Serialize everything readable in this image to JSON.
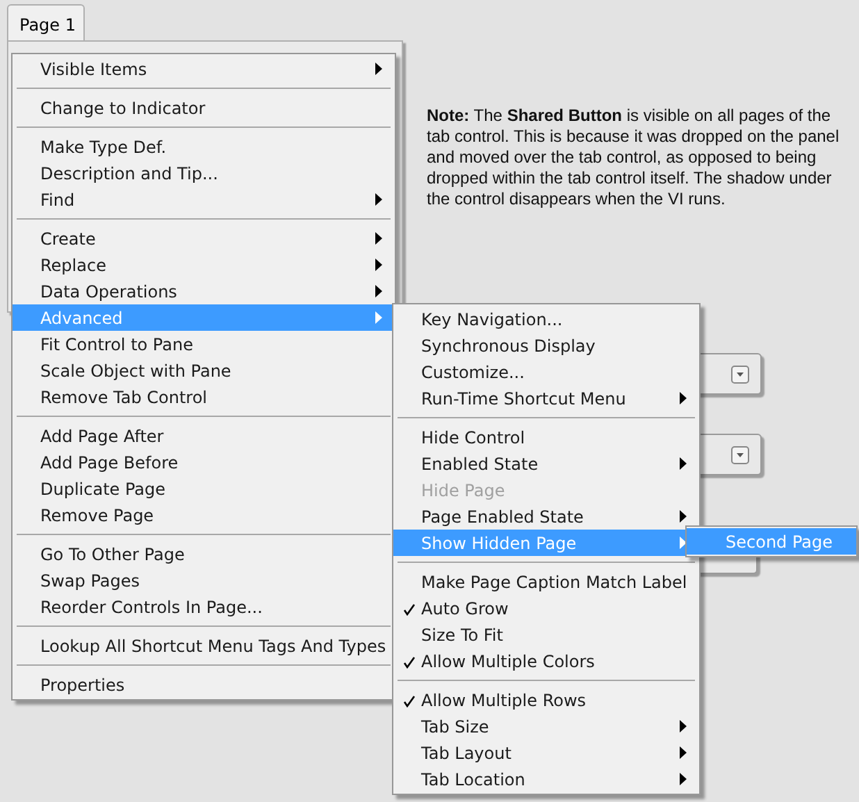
{
  "tab": {
    "label": "Page 1",
    "selected": true
  },
  "note": "**Note:** The **Shared Button** is visible on all pages of the tab control. This is because it was dropped on the panel and moved over the tab control, as opposed to being dropped within the tab control itself. The shadow under the control disappears when the VI runs.",
  "context_menu": {
    "groups": [
      [
        {
          "label": "Visible Items",
          "submenu": true,
          "selected": false
        }
      ],
      [
        {
          "label": "Change to Indicator",
          "submenu": false,
          "selected": false
        }
      ],
      [
        {
          "label": "Make Type Def.",
          "submenu": false,
          "selected": false
        },
        {
          "label": "Description and Tip...",
          "submenu": false,
          "selected": false
        },
        {
          "label": "Find",
          "submenu": true,
          "selected": false
        }
      ],
      [
        {
          "label": "Create",
          "submenu": true,
          "selected": false
        },
        {
          "label": "Replace",
          "submenu": true,
          "selected": false
        },
        {
          "label": "Data Operations",
          "submenu": true,
          "selected": false
        },
        {
          "label": "Advanced",
          "submenu": true,
          "selected": true
        },
        {
          "label": "Fit Control to Pane",
          "submenu": false,
          "selected": false
        },
        {
          "label": "Scale Object with Pane",
          "submenu": false,
          "selected": false
        },
        {
          "label": "Remove Tab Control",
          "submenu": false,
          "selected": false
        }
      ],
      [
        {
          "label": "Add Page After",
          "submenu": false,
          "selected": false
        },
        {
          "label": "Add Page Before",
          "submenu": false,
          "selected": false
        },
        {
          "label": "Duplicate Page",
          "submenu": false,
          "selected": false
        },
        {
          "label": "Remove Page",
          "submenu": false,
          "selected": false
        }
      ],
      [
        {
          "label": "Go To Other Page",
          "submenu": false,
          "selected": false
        },
        {
          "label": "Swap Pages",
          "submenu": false,
          "selected": false
        },
        {
          "label": "Reorder Controls In Page...",
          "submenu": false,
          "selected": false
        }
      ],
      [
        {
          "label": "Lookup All Shortcut Menu Tags And Types",
          "submenu": false,
          "selected": false
        }
      ],
      [
        {
          "label": "Properties",
          "submenu": false,
          "selected": false
        }
      ]
    ]
  },
  "advanced_submenu": {
    "groups": [
      [
        {
          "label": "Key Navigation...",
          "submenu": false,
          "selected": false,
          "checked": false,
          "disabled": false
        },
        {
          "label": "Synchronous Display",
          "submenu": false,
          "selected": false,
          "checked": false,
          "disabled": false
        },
        {
          "label": "Customize...",
          "submenu": false,
          "selected": false,
          "checked": false,
          "disabled": false
        },
        {
          "label": "Run-Time Shortcut Menu",
          "submenu": true,
          "selected": false,
          "checked": false,
          "disabled": false
        }
      ],
      [
        {
          "label": "Hide Control",
          "submenu": false,
          "selected": false,
          "checked": false,
          "disabled": false
        },
        {
          "label": "Enabled State",
          "submenu": true,
          "selected": false,
          "checked": false,
          "disabled": false
        },
        {
          "label": "Hide Page",
          "submenu": false,
          "selected": false,
          "checked": false,
          "disabled": true
        },
        {
          "label": "Page Enabled State",
          "submenu": true,
          "selected": false,
          "checked": false,
          "disabled": false
        },
        {
          "label": "Show Hidden Page",
          "submenu": true,
          "selected": true,
          "checked": false,
          "disabled": false
        }
      ],
      [
        {
          "label": "Make Page Caption Match Label",
          "submenu": false,
          "selected": false,
          "checked": false,
          "disabled": false
        },
        {
          "label": "Auto Grow",
          "submenu": false,
          "selected": false,
          "checked": true,
          "disabled": false
        },
        {
          "label": "Size To Fit",
          "submenu": false,
          "selected": false,
          "checked": false,
          "disabled": false
        },
        {
          "label": "Allow Multiple Colors",
          "submenu": false,
          "selected": false,
          "checked": true,
          "disabled": false
        }
      ],
      [
        {
          "label": "Allow Multiple Rows",
          "submenu": false,
          "selected": false,
          "checked": true,
          "disabled": false
        },
        {
          "label": "Tab Size",
          "submenu": true,
          "selected": false,
          "checked": false,
          "disabled": false
        },
        {
          "label": "Tab Layout",
          "submenu": true,
          "selected": false,
          "checked": false,
          "disabled": false
        },
        {
          "label": "Tab Location",
          "submenu": true,
          "selected": false,
          "checked": false,
          "disabled": false
        }
      ]
    ]
  },
  "hidden_pages_submenu": {
    "items": [
      {
        "label": "Second Page",
        "selected": true
      }
    ]
  }
}
